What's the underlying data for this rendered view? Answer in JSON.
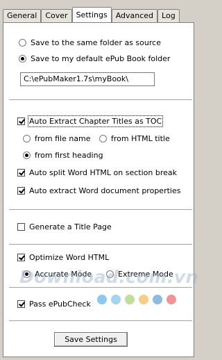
{
  "tabs": [
    "General",
    "Cover",
    "Settings",
    "Advanced",
    "Log"
  ],
  "output": {
    "same_folder_label": "Save to the same folder as source",
    "default_folder_label": "Save to my default ePub Book folder",
    "folder_path": "C:\\ePubMaker1.7s\\myBook\\"
  },
  "toc": {
    "auto_extract_label": "Auto Extract Chapter Titles as TOC",
    "from_file_name": "from file name",
    "from_html_title": "from HTML title",
    "from_first_heading": "from first heading",
    "auto_split_label": "Auto split Word HTML on section break",
    "auto_extract_props_label": "Auto extract Word document properties"
  },
  "title_page": {
    "label": "Generate a Title Page"
  },
  "optimize": {
    "label": "Optimize Word HTML",
    "accurate": "Accurate Mode",
    "extreme": "Extreme Mode"
  },
  "check": {
    "label": "Pass ePubCheck"
  },
  "save_button": "Save Settings",
  "watermark": {
    "text": "Download.com.vn",
    "dot_colors": [
      "#5ab4e6",
      "#7cc3ea",
      "#a5cf6f",
      "#f3b94f",
      "#5b9fd3",
      "#e86b6b"
    ]
  },
  "colors": {
    "panel": "#ffffff",
    "chrome": "#d4d0c8"
  }
}
